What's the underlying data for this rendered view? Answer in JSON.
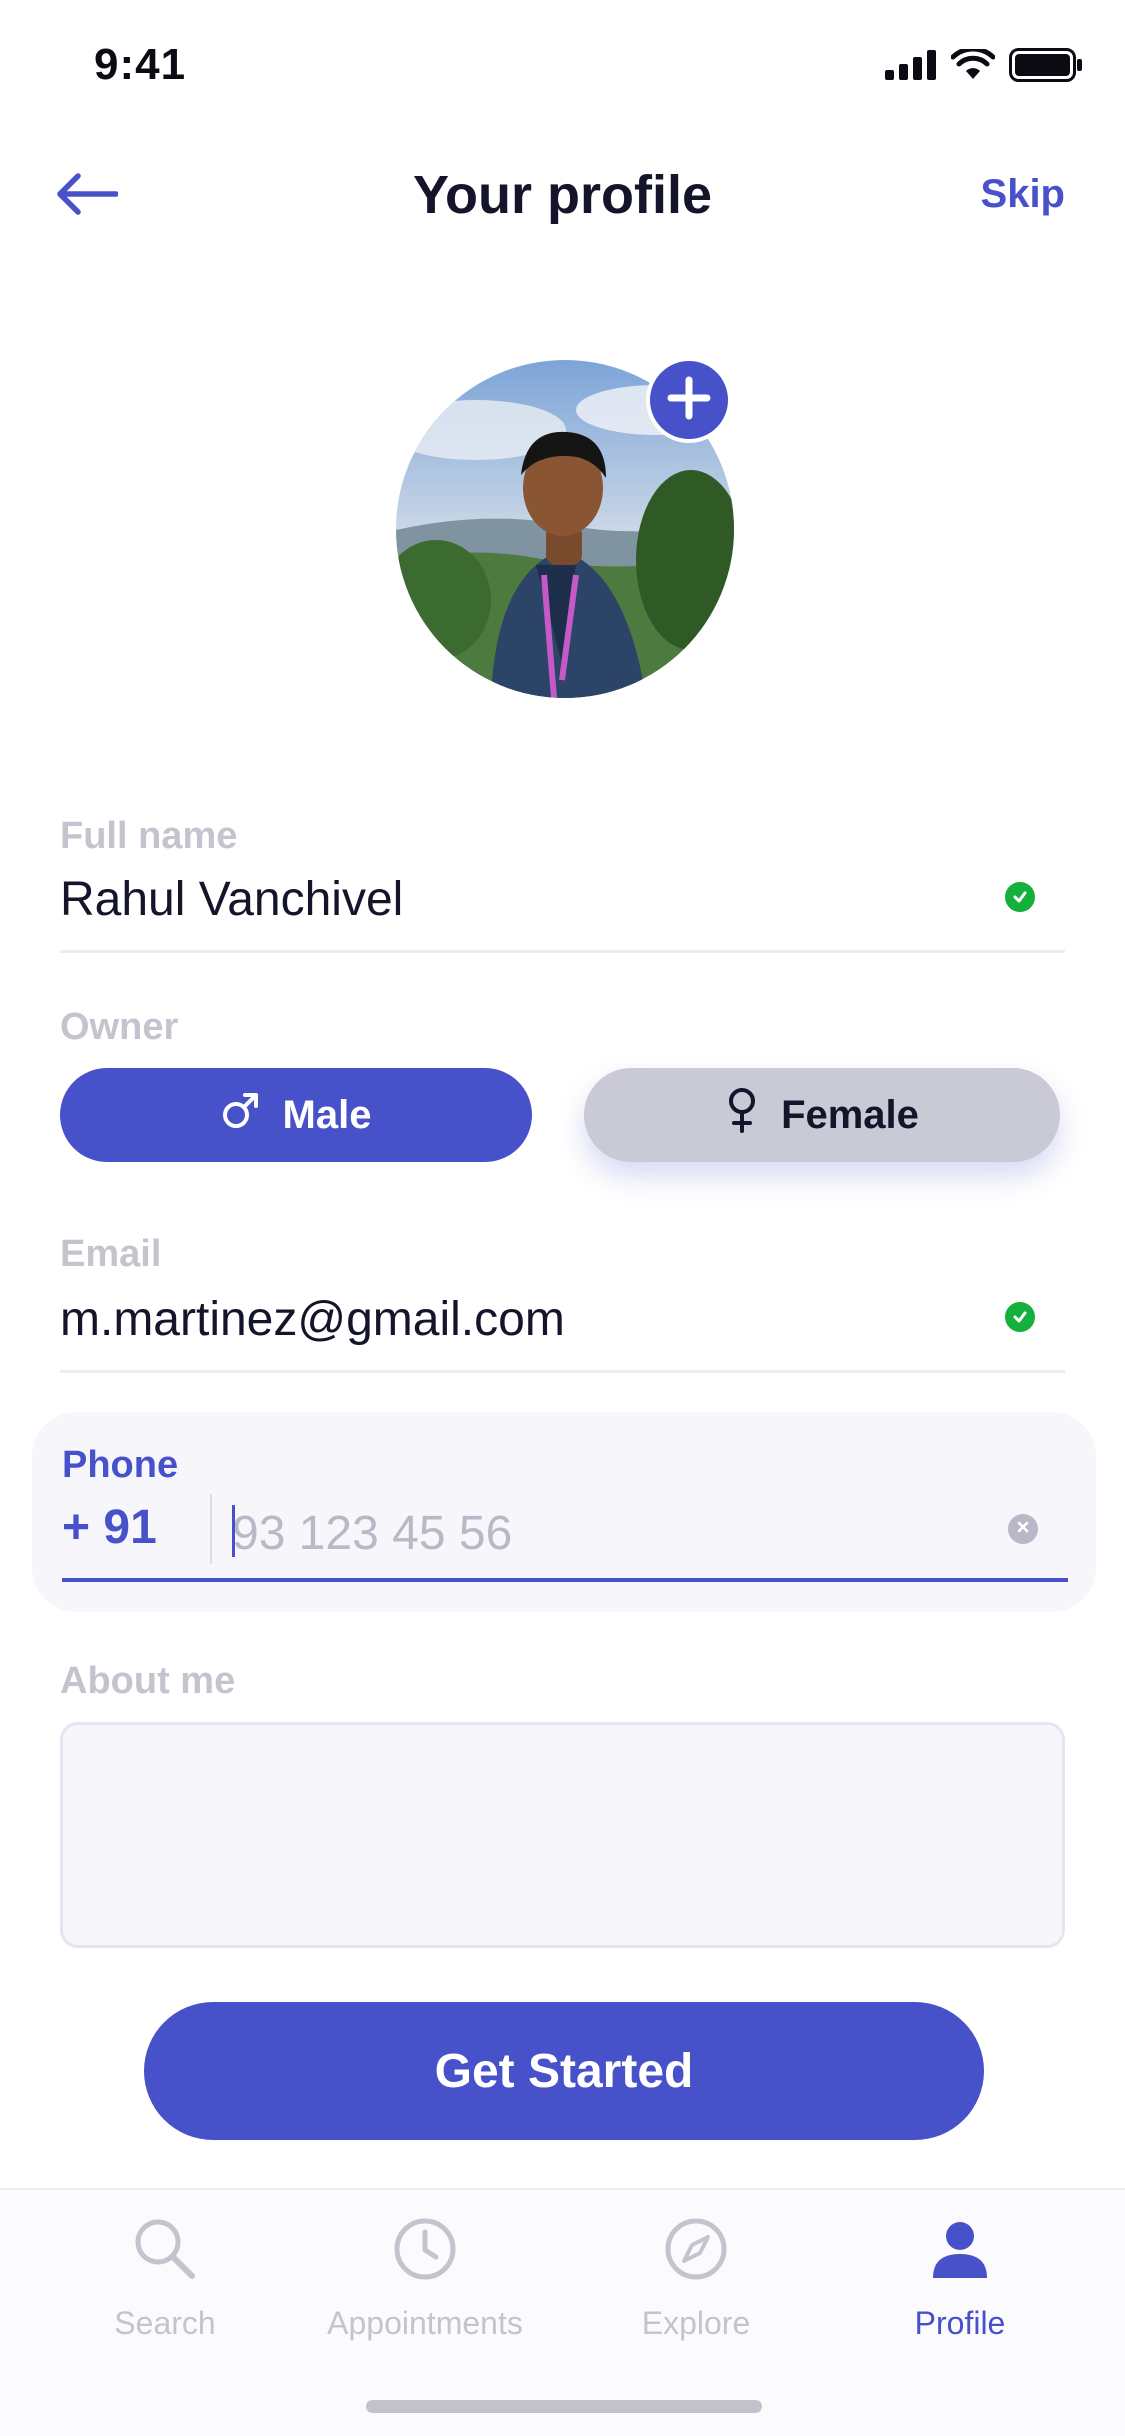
{
  "status_bar": {
    "time": "9:41"
  },
  "header": {
    "title": "Your profile",
    "skip_label": "Skip"
  },
  "profile": {
    "full_name_label": "Full name",
    "full_name_value": "Rahul Vanchivel",
    "owner_label": "Owner",
    "gender_options": [
      {
        "label": "Male",
        "icon": "male-icon",
        "selected": true
      },
      {
        "label": "Female",
        "icon": "female-icon",
        "selected": false
      }
    ],
    "email_label": "Email",
    "email_value": "m.martinez@gmail.com",
    "phone_label": "Phone",
    "phone_country_code": "+ 91",
    "phone_placeholder": "93 123 45 56",
    "about_label": "About me",
    "about_value": ""
  },
  "cta": {
    "label": "Get Started"
  },
  "tab_bar": {
    "items": [
      {
        "label": "Search",
        "icon": "search-icon",
        "active": false
      },
      {
        "label": "Appointments",
        "icon": "clock-icon",
        "active": false
      },
      {
        "label": "Explore",
        "icon": "compass-icon",
        "active": false
      },
      {
        "label": "Profile",
        "icon": "user-icon",
        "active": true
      }
    ]
  },
  "colors": {
    "accent": "#4751c9",
    "text": "#14142b",
    "muted": "#c4c4cf",
    "success": "#15b03c",
    "female_button_bg": "#cac9d6"
  }
}
